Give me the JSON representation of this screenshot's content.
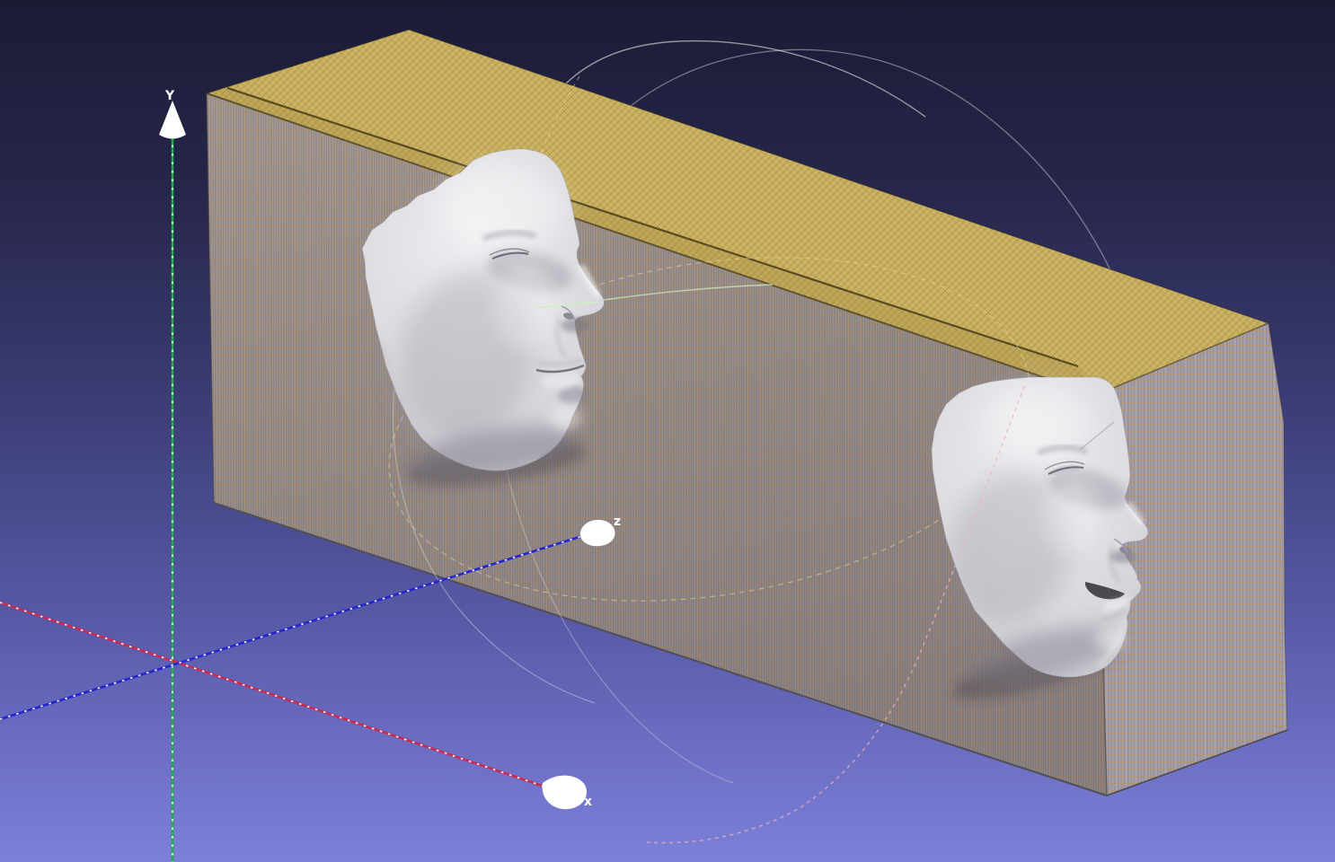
{
  "scene": {
    "background": {
      "top": "#1b1b36",
      "upper_mid": "#26264a",
      "mid": "#3a3b72",
      "lower_mid": "#585aa8",
      "bottom": "#7c80d9"
    },
    "axes": {
      "y": {
        "label": "Y",
        "color": "#1fae49"
      },
      "x": {
        "label": "x",
        "color": "#cc2952"
      },
      "z": {
        "label": "z",
        "color": "#2525cf"
      }
    },
    "trackball": {
      "arc_color": "#fdfaf2",
      "equator_color": "#eee4aa",
      "pink_arc_color": "#f2b2b2",
      "nose_segment_color": "#cdeec0"
    },
    "slab": {
      "top_color": "#c9b364",
      "front_color": "#a89d90",
      "right_color": "#b2adb8",
      "seam_color": "#564b22",
      "edge_color": "#5e5430"
    },
    "face_mesh_color": "#dddce1"
  }
}
